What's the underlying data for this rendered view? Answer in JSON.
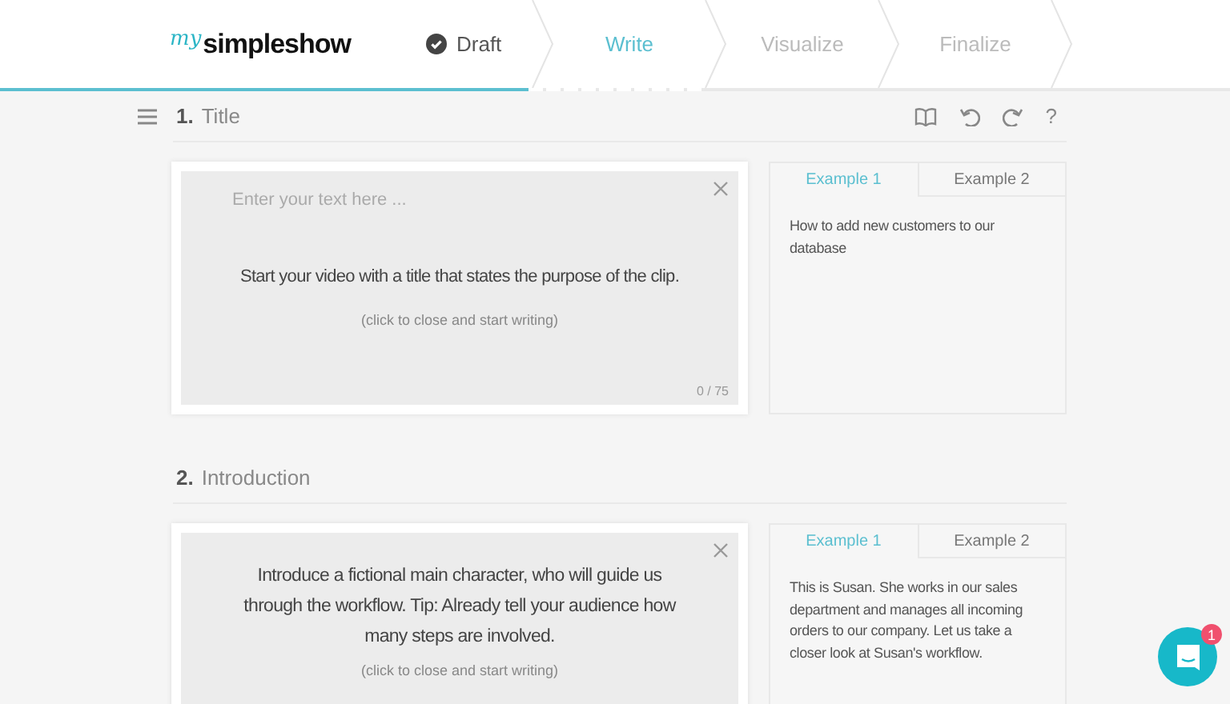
{
  "logo": {
    "prefix": "my",
    "name": "simpleshow"
  },
  "steps": [
    {
      "label": "Draft",
      "done": true,
      "selected": false
    },
    {
      "label": "Write",
      "done": false,
      "selected": true
    },
    {
      "label": "Visualize",
      "done": false,
      "selected": false
    },
    {
      "label": "Finalize",
      "done": false,
      "selected": false
    }
  ],
  "sections": [
    {
      "number": "1.",
      "title": "Title",
      "placeholder": "Enter your text here ...",
      "hint": "Start your video with a title that states the purpose of the clip.",
      "close_hint": "(click to close and start writing)",
      "counter": "0 / 75",
      "examples": [
        {
          "label": "Example 1",
          "selected": true
        },
        {
          "label": "Example 2",
          "selected": false
        }
      ],
      "example_text": "How to add new customers to our database"
    },
    {
      "number": "2.",
      "title": "Introduction",
      "hint": "Introduce a fictional main character, who will guide us through the workflow. Tip: Already tell your audience how many steps are involved.",
      "close_hint": "(click to close and start writing)",
      "examples": [
        {
          "label": "Example 1",
          "selected": true
        },
        {
          "label": "Example 2",
          "selected": false
        }
      ],
      "example_text": "This is Susan. She works in our sales department and manages all incoming orders to our company. Let us take a closer look at Susan's workflow."
    }
  ],
  "toolbar": {
    "help": "?"
  },
  "progress": {
    "level": 0.43
  },
  "chat": {
    "badge": "1"
  }
}
